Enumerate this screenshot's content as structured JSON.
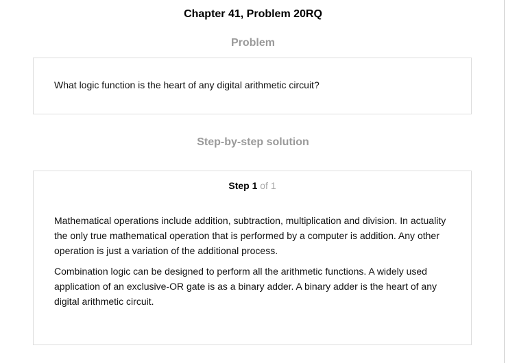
{
  "header": {
    "title": "Chapter 41, Problem 20RQ"
  },
  "problem": {
    "heading": "Problem",
    "text": "What logic function is the heart of any digital arithmetic circuit?"
  },
  "solution": {
    "heading": "Step-by-step solution",
    "step": {
      "label": "Step 1",
      "total": "of 1"
    },
    "paragraphs": [
      "Mathematical operations include addition, subtraction, multiplication and division. In actuality the only true mathematical operation that is performed by a computer is addition. Any other operation is just a variation of the additional process.",
      "Combination logic can be designed to perform all the arithmetic functions. A widely used application of an exclusive-OR gate is as a binary adder. A binary adder is the heart of any digital arithmetic circuit."
    ]
  }
}
